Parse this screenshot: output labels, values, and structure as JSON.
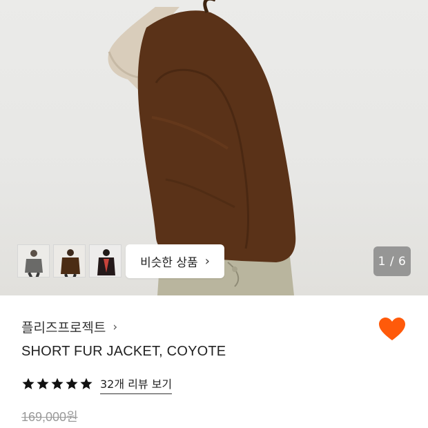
{
  "gallery": {
    "similar_label": "비슷한 상품",
    "similar_chevron": "›",
    "pager": "1 / 6",
    "thumbnails": [
      {
        "name": "thumbnail-1"
      },
      {
        "name": "thumbnail-2"
      },
      {
        "name": "thumbnail-3"
      }
    ]
  },
  "product": {
    "brand": "플리즈프로젝트",
    "brand_chevron": "›",
    "title": "SHORT FUR JACKET, COYOTE",
    "rating": 5,
    "reviews_label": "32개 리뷰 보기",
    "original_price": "169,000원",
    "favorite_color": "#ff5a0a"
  },
  "icons": {
    "favorite": "heart-icon",
    "star": "star-icon",
    "chevron": "chevron-right-icon"
  }
}
